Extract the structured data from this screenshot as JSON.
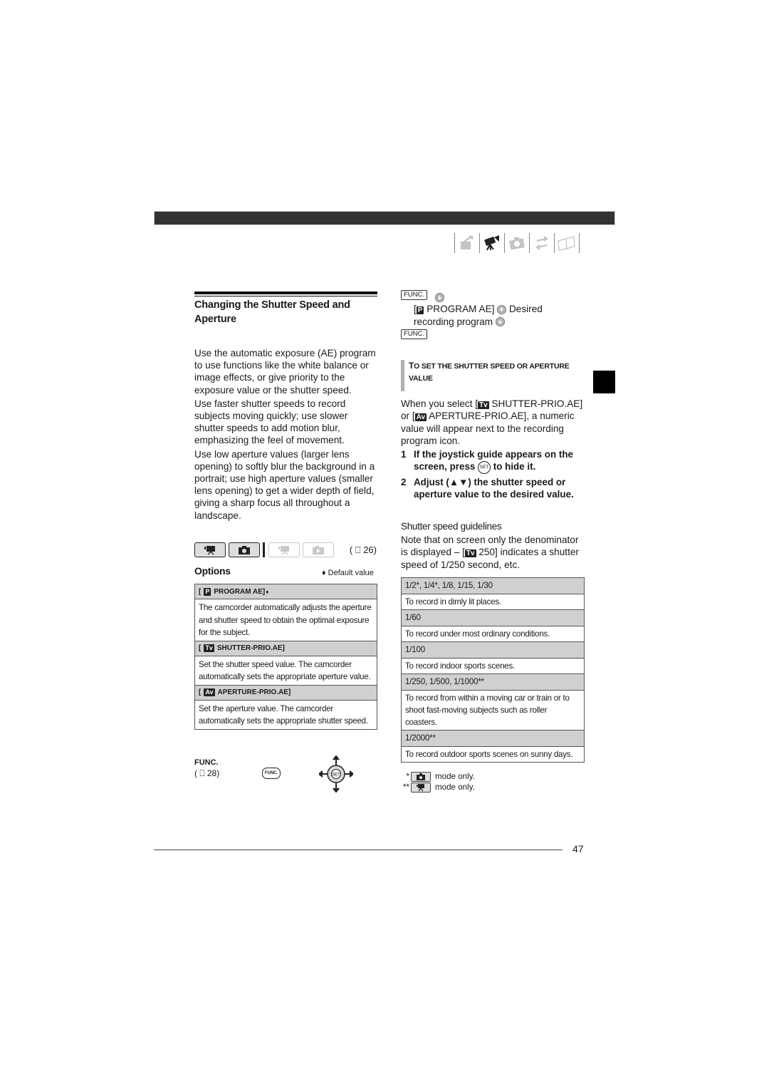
{
  "header": {
    "section_icons": [
      "preparations-icon",
      "video-camera-icon",
      "photo-camera-icon",
      "transfer-icon",
      "book-icon"
    ],
    "active_section": "video-camera-icon"
  },
  "left": {
    "title": "Changing the Shutter Speed and Aperture",
    "intro_paragraphs": [
      "Use the automatic exposure (AE) program to use functions like the white balance or image effects, or give priority to the exposure value or the shutter speed.",
      "Use faster shutter speeds to record subjects moving quickly; use slower shutter speeds to add motion blur, emphasizing the feel of movement.",
      "Use low aperture values (larger lens opening) to softly blur the background in a portrait; use high aperture values (smaller lens opening) to get a wider depth of field, giving a sharp focus all throughout a landscape."
    ],
    "mode_ref": "( ⎕ 26)",
    "options_label": "Options",
    "default_value_label": "♦ Default value",
    "options": [
      {
        "badge": "P",
        "name": "PROGRAM AE]",
        "default": "♦",
        "description": "The camcorder automatically adjusts the aperture and shutter speed to obtain the optimal exposure for the subject."
      },
      {
        "badge": "Tv",
        "name": "SHUTTER-PRIO.AE]",
        "default": "",
        "description": "Set the shutter speed value. The camcorder automatically sets the appropriate aperture value."
      },
      {
        "badge": "Av",
        "name": "APERTURE-PRIO.AE]",
        "default": "",
        "description": "Set the aperture value. The camcorder automatically sets the appropriate shutter speed."
      }
    ],
    "func_label": "FUNC.",
    "func_ref": "( ⎕ 28)",
    "func_button_text": "FUNC.",
    "joystick_text": "SET"
  },
  "right": {
    "func_key": "FUNC.",
    "program_ae_line": "PROGRAM AE]",
    "desired_text": "Desired",
    "recording_program_text": "recording program",
    "subhead_first": "T",
    "subhead_rest": "o set the shutter speed or aperture value",
    "when_text_1": "When you select [",
    "when_text_2": " SHUTTER-PRIO.AE] or [",
    "when_text_3": " APERTURE-PRIO.AE], a numeric value will appear next to the recording program icon.",
    "steps": [
      {
        "num": "1",
        "before": "If the joystick guide appears on the screen, press ",
        "icon": "SET",
        "after": " to hide it."
      },
      {
        "num": "2",
        "before": "Adjust (▲▼) the shutter speed or aperture value to the desired value.",
        "icon": "",
        "after": ""
      }
    ],
    "ssg_title": "Shutter speed guidelines",
    "ssg_note_1": "Note that on screen only the denominator is displayed – [",
    "ssg_note_2": " 250] indicates a shutter speed of 1/250 second, etc.",
    "speed_table": [
      {
        "speeds": "1/2*, 1/4*, 1/8, 1/15, 1/30",
        "use": "To record in dimly lit places."
      },
      {
        "speeds": "1/60",
        "use": "To record under most ordinary conditions."
      },
      {
        "speeds": "1/100",
        "use": "To record indoor sports scenes."
      },
      {
        "speeds": "1/250, 1/500, 1/1000**",
        "use": "To record from within a moving car or train or to shoot fast-moving subjects such as roller coasters."
      },
      {
        "speeds": "1/2000**",
        "use": "To record outdoor sports scenes on sunny days."
      }
    ],
    "footnotes": [
      {
        "mark": "*",
        "icon": "photo-mode-icon",
        "text": "mode only."
      },
      {
        "mark": "**",
        "icon": "video-mode-icon",
        "text": "mode only."
      }
    ]
  },
  "footer": {
    "page_number": "47"
  }
}
